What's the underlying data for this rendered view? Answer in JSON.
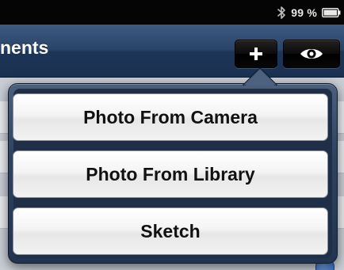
{
  "status_bar": {
    "battery_text": "99 %",
    "bluetooth_icon": "bluetooth-icon",
    "battery_icon": "battery-icon"
  },
  "nav_bar": {
    "title": "nents",
    "add_button_icon": "plus-icon",
    "view_button_icon": "eye-icon"
  },
  "popover": {
    "items": [
      {
        "label": "Photo From Camera"
      },
      {
        "label": "Photo From Library"
      },
      {
        "label": "Sketch"
      }
    ]
  },
  "colors": {
    "nav_bar": "#2a4468",
    "popover": "#2f4360",
    "status_bar": "#050505"
  }
}
